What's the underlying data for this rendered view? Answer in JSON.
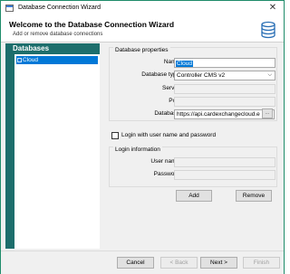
{
  "window": {
    "title": "Database Connection Wizard",
    "close_glyph": "✕"
  },
  "header": {
    "title": "Welcome to the Database Connection Wizard",
    "subtitle": "Add or remove database connections",
    "icon": "database-icon"
  },
  "databases": {
    "header": "Databases",
    "items": [
      {
        "label": "Cloud",
        "selected": true
      }
    ]
  },
  "properties": {
    "section_title": "Database properties",
    "name_label": "Name:",
    "name_value": "Cloud",
    "type_label": "Database type:",
    "type_value": "Controller CMS v2",
    "server_label": "Server:",
    "server_value": "",
    "port_label": "Port:",
    "port_value": "",
    "database_label": "Database:",
    "database_value": "https://api.cardexchangecloud.e",
    "browse_label": "...",
    "dropdown_glyph": "⌵"
  },
  "login": {
    "checkbox_label": "Login with user name and password",
    "checked": false,
    "section_title": "Login information",
    "username_label": "User name:",
    "username_value": "",
    "password_label": "Password:",
    "password_value": ""
  },
  "actions": {
    "add_label": "Add",
    "remove_label": "Remove"
  },
  "footer": {
    "cancel_label": "Cancel",
    "back_label": "< Back",
    "next_label": "Next >",
    "finish_label": "Finish"
  },
  "colors": {
    "accent": "#0078d7",
    "panel": "#1d6e6c",
    "border": "#1e8c6a"
  }
}
